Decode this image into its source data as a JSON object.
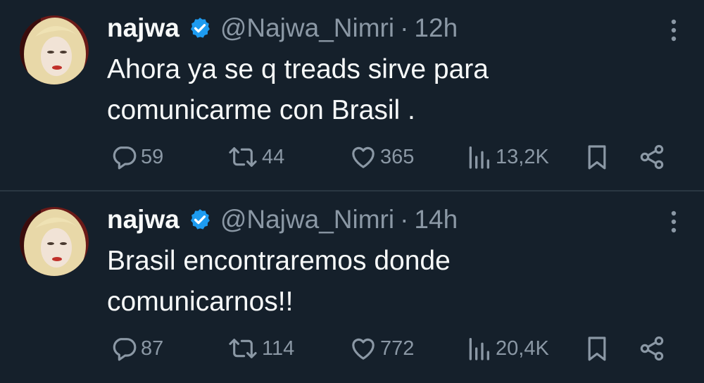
{
  "colors": {
    "background": "#15202b",
    "text_primary": "#f7f9f9",
    "text_secondary": "#8b98a5",
    "verified": "#1d9bf0",
    "divider": "#2a3742"
  },
  "icons": {
    "reply": "speech-bubble",
    "retweet": "retweet-arrows",
    "like": "heart",
    "views": "bar-chart",
    "bookmark": "bookmark",
    "share": "share-nodes",
    "more": "vertical-ellipsis",
    "verified": "verified-badge"
  },
  "tweets": [
    {
      "author": {
        "name": "najwa",
        "handle": "@Najwa_Nimri"
      },
      "separator": "·",
      "time": "12h",
      "text_lines": [
        "Ahora ya se q treads sirve para",
        "comunicarme con Brasil ."
      ],
      "stats": {
        "replies": "59",
        "retweets": "44",
        "likes": "365",
        "views": "13,2K"
      }
    },
    {
      "author": {
        "name": "najwa",
        "handle": "@Najwa_Nimri"
      },
      "separator": "·",
      "time": "14h",
      "text_lines": [
        "Brasil encontraremos donde",
        "comunicarnos!!"
      ],
      "stats": {
        "replies": "87",
        "retweets": "114",
        "likes": "772",
        "views": "20,4K"
      }
    }
  ]
}
